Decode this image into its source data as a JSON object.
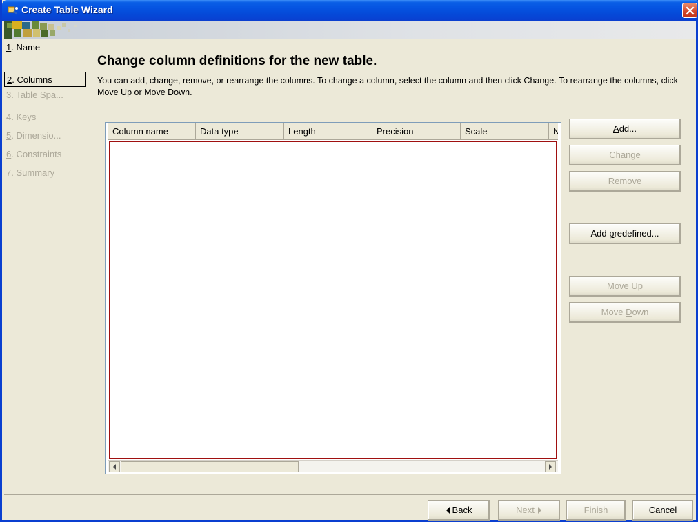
{
  "window": {
    "title": "Create Table Wizard"
  },
  "nav": {
    "items": [
      {
        "num": "1",
        "rest": ". Name",
        "state": "normal"
      },
      {
        "num": "2",
        "rest": ". Columns",
        "state": "active"
      },
      {
        "num": "3",
        "rest": ". Table Spa...",
        "state": "disabled"
      },
      {
        "num": "4",
        "rest": ". Keys",
        "state": "disabled"
      },
      {
        "num": "5",
        "rest": ". Dimensio...",
        "state": "disabled"
      },
      {
        "num": "6",
        "rest": ". Constraints",
        "state": "disabled"
      },
      {
        "num": "7",
        "rest": ". Summary",
        "state": "disabled"
      }
    ]
  },
  "main": {
    "heading": "Change column definitions for the new table.",
    "description": "You can add, change, remove, or rearrange the columns. To change a column, select the column and then click Change. To rearrange the columns, click Move Up or Move Down."
  },
  "table": {
    "columns": [
      "Column name",
      "Data type",
      "Length",
      "Precision",
      "Scale",
      "N"
    ],
    "rows": []
  },
  "side_buttons": {
    "add": {
      "pre": "",
      "ul": "A",
      "post": "dd..."
    },
    "change": {
      "pre": "Change",
      "ul": "",
      "post": ""
    },
    "remove": {
      "pre": "",
      "ul": "R",
      "post": "emove"
    },
    "add_predefined": {
      "pre": "Add ",
      "ul": "p",
      "post": "redefined..."
    },
    "move_up": {
      "pre": "Move ",
      "ul": "U",
      "post": "p"
    },
    "move_down": {
      "pre": "Move ",
      "ul": "D",
      "post": "own"
    }
  },
  "footer": {
    "back": {
      "pre": "",
      "ul": "B",
      "post": "ack"
    },
    "next": {
      "pre": "",
      "ul": "N",
      "post": "ext"
    },
    "finish": {
      "pre": "",
      "ul": "F",
      "post": "inish"
    },
    "cancel": "Cancel"
  }
}
